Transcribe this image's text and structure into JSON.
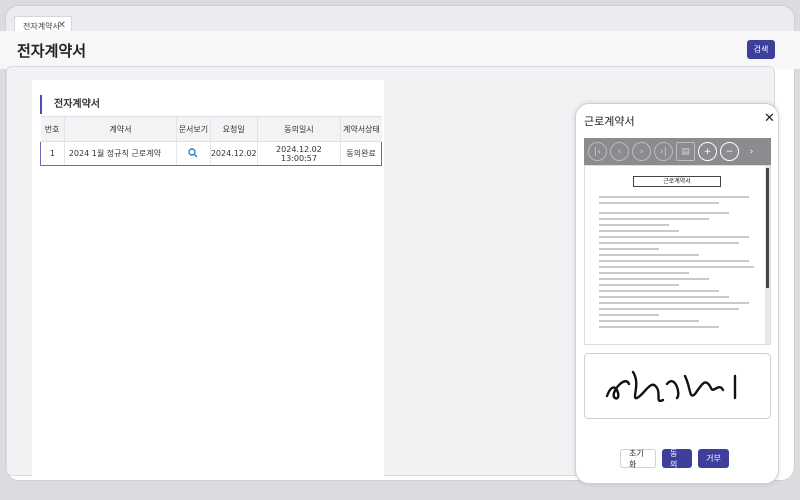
{
  "tabs": [
    {
      "label": "전자계약서",
      "close": "✕"
    }
  ],
  "page": {
    "title": "전자계약서",
    "search_button": "검색"
  },
  "section": {
    "title": "전자계약서"
  },
  "table": {
    "columns": [
      "번호",
      "계약서",
      "문서보기",
      "요청일",
      "동의일시",
      "계약서상태"
    ],
    "rows": [
      {
        "no": "1",
        "title": "2024 1월 정규직 근로계약",
        "view_icon": "search-icon",
        "request_date": "2024.12.02",
        "agree_datetime": "2024.12.02 13:00:57",
        "status": "동의완료"
      }
    ]
  },
  "modal": {
    "title": "근로계약서",
    "close": "✕",
    "document_title": "근로계약서",
    "buttons": {
      "reset": "초기화",
      "agree": "동의",
      "reject": "거부"
    }
  },
  "colors": {
    "accent": "#3d3f9a",
    "selected_border": "#6a6cb8"
  }
}
